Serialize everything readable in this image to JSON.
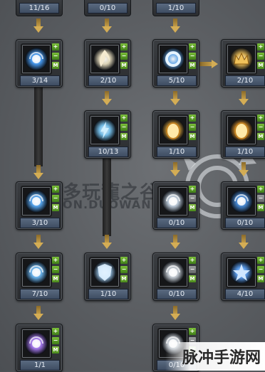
{
  "top_row_values": [
    "11/16",
    "0/10",
    "1/10"
  ],
  "skills": [
    {
      "id": "s1",
      "value": "3/14",
      "glyph": "orb-blue",
      "accent": "#4aa3ff",
      "buttons": [
        "+",
        "−",
        "M"
      ],
      "gray": []
    },
    {
      "id": "s2",
      "value": "2/10",
      "glyph": "flame-white",
      "accent": "#f2e8c8",
      "buttons": [
        "+",
        "−",
        "M"
      ],
      "gray": []
    },
    {
      "id": "s3",
      "value": "5/10",
      "glyph": "ring-blue",
      "accent": "#6fb8ff",
      "buttons": [
        "+",
        "−",
        "M"
      ],
      "gray": []
    },
    {
      "id": "s4",
      "value": "2/10",
      "glyph": "crown-gold",
      "accent": "#f0c25a",
      "buttons": [
        "+",
        "−",
        "M"
      ],
      "gray": []
    },
    {
      "id": "s5",
      "value": "10/13",
      "glyph": "bolt-blue",
      "accent": "#7fd0ff",
      "buttons": [
        "+",
        "−",
        "M"
      ],
      "gray": []
    },
    {
      "id": "s6",
      "value": "1/10",
      "glyph": "egg-gold",
      "accent": "#e8b040",
      "buttons": [
        "+",
        "−",
        "M"
      ],
      "gray": []
    },
    {
      "id": "s7",
      "value": "1/10",
      "glyph": "sun-gold",
      "accent": "#f0a030",
      "buttons": [
        "+",
        "−",
        "M"
      ],
      "gray": []
    },
    {
      "id": "s8",
      "value": "3/10",
      "glyph": "spark-blue",
      "accent": "#5ab0ff",
      "buttons": [
        "+",
        "−",
        "M"
      ],
      "gray": []
    },
    {
      "id": "s9",
      "value": "0/10",
      "glyph": "ward-silver",
      "accent": "#c8d8e8",
      "buttons": [
        "+",
        "−",
        "M"
      ],
      "gray": [
        "−"
      ]
    },
    {
      "id": "s10",
      "value": "0/10",
      "glyph": "orb-deep",
      "accent": "#4a90e0",
      "buttons": [
        "+",
        "−",
        "M"
      ],
      "gray": [
        "−"
      ]
    },
    {
      "id": "s11",
      "value": "7/10",
      "glyph": "swirl-blue",
      "accent": "#70c0ff",
      "buttons": [
        "+",
        "−",
        "M"
      ],
      "gray": []
    },
    {
      "id": "s12",
      "value": "1/10",
      "glyph": "shield-ice",
      "accent": "#a8d8ff",
      "buttons": [
        "+",
        "−",
        "M"
      ],
      "gray": []
    },
    {
      "id": "s13",
      "value": "0/10",
      "glyph": "spirit-silver",
      "accent": "#d0d8e0",
      "buttons": [
        "+",
        "−",
        "M"
      ],
      "gray": [
        "−"
      ]
    },
    {
      "id": "s14",
      "value": "4/10",
      "glyph": "star-blue",
      "accent": "#60a8ff",
      "buttons": [
        "+",
        "−",
        "M"
      ],
      "gray": []
    },
    {
      "id": "s15",
      "value": "1/1",
      "glyph": "orb-purple",
      "accent": "#b080ff",
      "buttons": [
        "+",
        "−",
        "M"
      ],
      "gray": []
    },
    {
      "id": "s16",
      "value": "0/10",
      "glyph": "wisp-silver",
      "accent": "#d8e0e8",
      "buttons": [
        "+",
        "−",
        "M"
      ],
      "gray": [
        "−"
      ]
    }
  ],
  "watermark": {
    "line1": "多玩龍之谷",
    "line2": "ON.DUOWAN.CO"
  },
  "logo": {
    "text": "脉冲手游网"
  }
}
